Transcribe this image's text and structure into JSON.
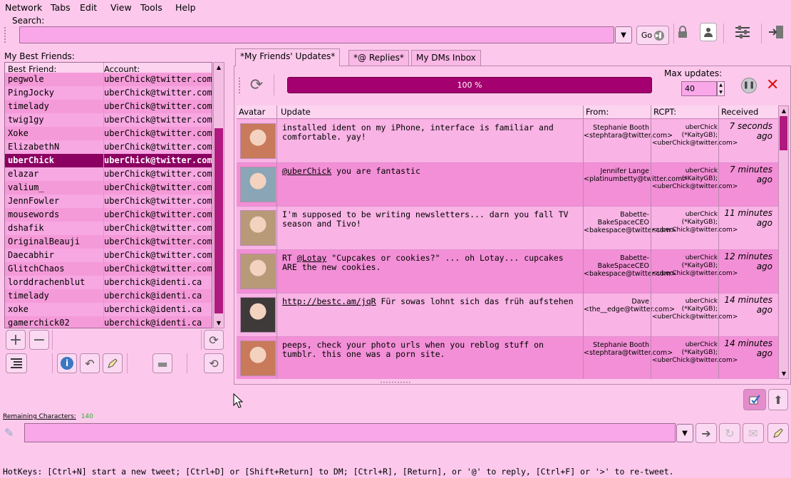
{
  "menu": [
    "Network",
    "Tabs",
    "Edit",
    "View",
    "Tools",
    "Help"
  ],
  "search": {
    "label": "Search:",
    "value": "",
    "go_label": "Go"
  },
  "friends": {
    "title": "My Best Friends:",
    "col_friend": "Best Friend:",
    "col_account": "Account:",
    "rows": [
      {
        "name": "pegwole",
        "account": "uberChick@twitter.com"
      },
      {
        "name": "PingJocky",
        "account": "uberChick@twitter.com"
      },
      {
        "name": "timelady",
        "account": "uberChick@twitter.com"
      },
      {
        "name": "twig1gy",
        "account": "uberChick@twitter.com"
      },
      {
        "name": "Xoke",
        "account": "uberChick@twitter.com"
      },
      {
        "name": "ElizabethN",
        "account": "uberChick@twitter.com"
      },
      {
        "name": "uberChick",
        "account": "uberChick@twitter.com"
      },
      {
        "name": "elazar",
        "account": "uberChick@twitter.com"
      },
      {
        "name": "valium_",
        "account": "uberChick@twitter.com"
      },
      {
        "name": "JennFowler",
        "account": "uberChick@twitter.com"
      },
      {
        "name": "mousewords",
        "account": "uberChick@twitter.com"
      },
      {
        "name": "dshafik",
        "account": "uberChick@twitter.com"
      },
      {
        "name": "OriginalBeauji",
        "account": "uberChick@twitter.com"
      },
      {
        "name": "Daecabhir",
        "account": "uberChick@twitter.com"
      },
      {
        "name": "GlitchChaos",
        "account": "uberChick@twitter.com"
      },
      {
        "name": "lorddrachenblut",
        "account": "uberchick@identi.ca"
      },
      {
        "name": "timelady",
        "account": "uberchick@identi.ca"
      },
      {
        "name": "xoke",
        "account": "uberchick@identi.ca"
      },
      {
        "name": "gamerchick02",
        "account": "uberchick@identi.ca"
      }
    ],
    "selected_index": 6
  },
  "tabs": [
    {
      "label": "*My Friends' Updates*",
      "active": true
    },
    {
      "label": "*@ Replies*",
      "active": false
    },
    {
      "label": "My DMs Inbox",
      "active": false
    }
  ],
  "progress": {
    "text": "100 %",
    "value": 1.0
  },
  "max_updates": {
    "label": "Max updates:",
    "value": "40"
  },
  "updates": {
    "headers": {
      "avatar": "Avatar",
      "update": "Update",
      "from": "From:",
      "rcpt": "RCPT:",
      "received": "Received"
    },
    "rows": [
      {
        "text_before": "installed ident on my iPhone, interface is familiar and comfortable. yay!",
        "link": "",
        "text_after": "",
        "from": "Stephanie Booth <stephtara@twitter.com>",
        "rcpt": "uberChick (*KaityGB); <uberChick@twitter.com>",
        "received": "7 seconds ago",
        "avatar_color": "#c97a5a"
      },
      {
        "text_before": "",
        "link": "@uberChick",
        "text_after": "  you are fantastic",
        "from": "Jennifer Lange <platinumbetty@twitter.com>",
        "rcpt": "uberChick (*KaityGB); <uberChick@twitter.com>",
        "received": "7 minutes ago",
        "avatar_color": "#8aa6b6"
      },
      {
        "text_before": "I'm supposed to be writing newsletters... darn you fall TV season and Tivo!",
        "link": "",
        "text_after": "",
        "from": "Babette-BakeSpaceCEO <bakespace@twitter.com>",
        "rcpt": "uberChick (*KaityGB); <uberChick@twitter.com>",
        "received": "11 minutes ago",
        "avatar_color": "#b89a78"
      },
      {
        "text_before": "RT ",
        "link": "@Lotay",
        "text_after": " \"Cupcakes or cookies?\" ... oh Lotay...  cupcakes ARE the new cookies.",
        "from": "Babette-BakeSpaceCEO <bakespace@twitter.com>",
        "rcpt": "uberChick (*KaityGB); <uberChick@twitter.com>",
        "received": "12 minutes ago",
        "avatar_color": "#b89a78"
      },
      {
        "text_before": "",
        "link": "http://bestc.am/jqR",
        "text_after": " Für sowas lohnt sich das früh aufstehen",
        "from": "Dave <the__edge@twitter.com>",
        "rcpt": "uberChick (*KaityGB); <uberChick@twitter.com>",
        "received": "14 minutes ago",
        "avatar_color": "#3e3a3a"
      },
      {
        "text_before": "peeps, check your photo urls when you reblog stuff on tumblr. this one was a porn site.",
        "link": "",
        "text_after": "",
        "from": "Stephanie Booth <stephtara@twitter.com>",
        "rcpt": "uberChick (*KaityGB); <uberChick@twitter.com>",
        "received": "14 minutes ago",
        "avatar_color": "#c97a5a"
      }
    ]
  },
  "remaining": {
    "label": "Remaining Characters:",
    "count": "140"
  },
  "compose": {
    "value": ""
  },
  "hotkeys": "HotKeys: [Ctrl+N] start a new tweet; [Ctrl+D] or [Shift+Return] to DM; [Ctrl+R], [Return], or '@' to reply, [Ctrl+F] or '>' to re-tweet.",
  "colors": {
    "accent": "#a4006f",
    "background": "#fcc9ec",
    "selected": "#8c0062"
  }
}
